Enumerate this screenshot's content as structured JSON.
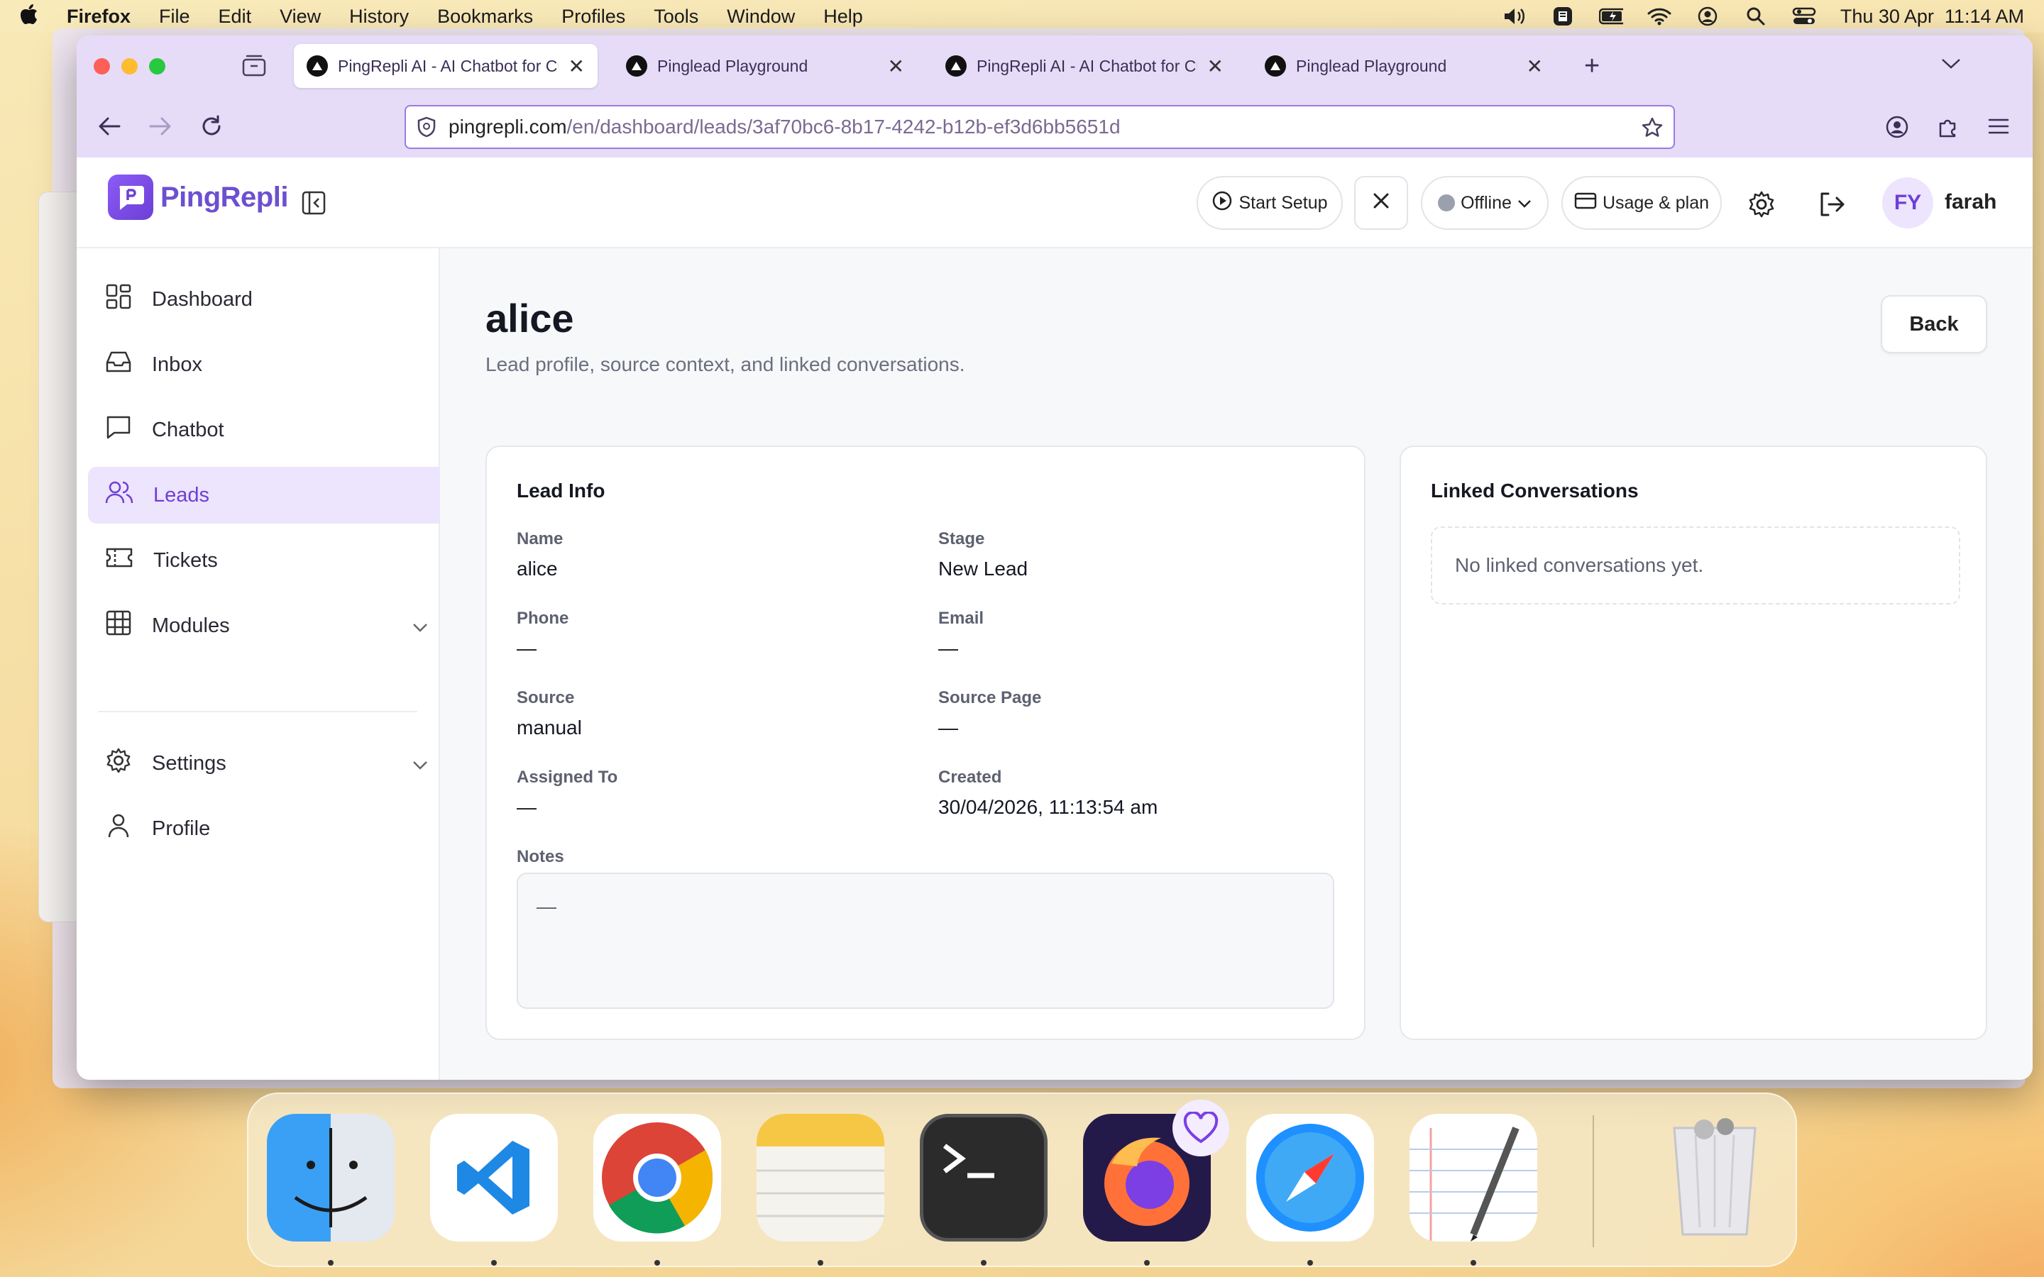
{
  "menubar": {
    "app": "Firefox",
    "items": [
      "File",
      "Edit",
      "View",
      "History",
      "Bookmarks",
      "Profiles",
      "Tools",
      "Window",
      "Help"
    ],
    "datetime": "Thu 30 Apr  11:14 AM"
  },
  "browser": {
    "tabs": [
      {
        "title": "PingRepli AI - AI Chatbot for Cu",
        "active": true
      },
      {
        "title": "Pinglead Playground",
        "active": false
      },
      {
        "title": "PingRepli AI - AI Chatbot for Cu",
        "active": false
      },
      {
        "title": "Pinglead Playground",
        "active": false
      }
    ],
    "url_host": "pingrepli.com",
    "url_path": "/en/dashboard/leads/3af70bc6-8b17-4242-b12b-ef3d6bb5651d"
  },
  "header": {
    "logo_text": "PingRepli",
    "start_setup": "Start Setup",
    "status": "Offline",
    "usage": "Usage & plan",
    "avatar_initials": "FY",
    "username": "farah"
  },
  "sidebar": {
    "items": [
      {
        "label": "Dashboard",
        "icon": "grid-icon"
      },
      {
        "label": "Inbox",
        "icon": "inbox-icon"
      },
      {
        "label": "Chatbot",
        "icon": "chat-icon"
      },
      {
        "label": "Leads",
        "icon": "users-icon",
        "active": true
      },
      {
        "label": "Tickets",
        "icon": "ticket-icon"
      },
      {
        "label": "Modules",
        "icon": "table-icon",
        "expandable": true
      }
    ],
    "bottom_items": [
      {
        "label": "Settings",
        "icon": "gear-icon",
        "expandable": true
      },
      {
        "label": "Profile",
        "icon": "user-icon"
      }
    ]
  },
  "page": {
    "title": "alice",
    "subtitle": "Lead profile, source context, and linked conversations.",
    "back": "Back"
  },
  "lead_info": {
    "title": "Lead Info",
    "fields": {
      "name": {
        "label": "Name",
        "value": "alice"
      },
      "stage": {
        "label": "Stage",
        "value": "New Lead"
      },
      "phone": {
        "label": "Phone",
        "value": "—"
      },
      "email": {
        "label": "Email",
        "value": "—"
      },
      "source": {
        "label": "Source",
        "value": "manual"
      },
      "source_page": {
        "label": "Source Page",
        "value": "—"
      },
      "assigned_to": {
        "label": "Assigned To",
        "value": "—"
      },
      "created": {
        "label": "Created",
        "value": "30/04/2026, 11:13:54 am"
      }
    },
    "notes_label": "Notes",
    "notes_value": "—"
  },
  "linked": {
    "title": "Linked Conversations",
    "empty": "No linked conversations yet."
  },
  "colors": {
    "accent": "#6d3fd6",
    "accent_light": "#ede4fd",
    "tab_bar": "#e6dcf8"
  },
  "dock": [
    "Finder",
    "Visual Studio Code",
    "Google Chrome",
    "Notes",
    "Terminal",
    "Firefox",
    "Safari",
    "TextEdit",
    "Trash"
  ]
}
